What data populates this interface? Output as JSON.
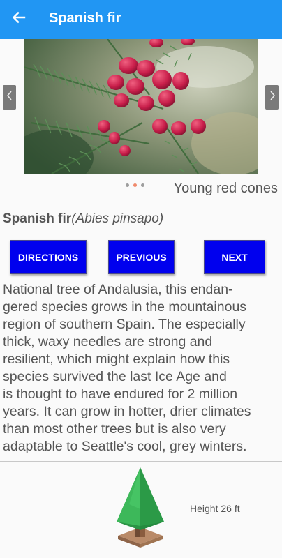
{
  "appbar": {
    "title": "Spanish fir",
    "back_icon": "arrow-back-icon",
    "color": "#2196f3"
  },
  "gallery": {
    "image_description": "Abies pinsapo branch with young red cones",
    "caption": "Young red cones",
    "dot_count": 3,
    "active_dot": 1,
    "prev_icon": "chevron-left-icon",
    "next_icon": "chevron-right-icon"
  },
  "species": {
    "common_name": "Spanish fir",
    "latin_name": "(Abies pinsapo)"
  },
  "buttons": {
    "directions": "DIRECTIONS",
    "previous": "PREVIOUS",
    "next": "NEXT",
    "color": "#0000ee"
  },
  "description": {
    "lines": [
      "National tree of Andalusia, this endan-",
      "gered species grows in the mountainous",
      "region of southern Spain. The especially",
      "thick, waxy needles are strong and",
      "resilient, which might explain how this",
      "species survived the last Ice Age and",
      "is thought to have endured for 2 million",
      "years. It can grow in hotter, drier climates",
      "than most other trees but is also very",
      "adaptable to Seattle's cool, grey winters."
    ]
  },
  "footer": {
    "tree_icon": "tree-icon",
    "height_label": "Height 26 ft"
  }
}
